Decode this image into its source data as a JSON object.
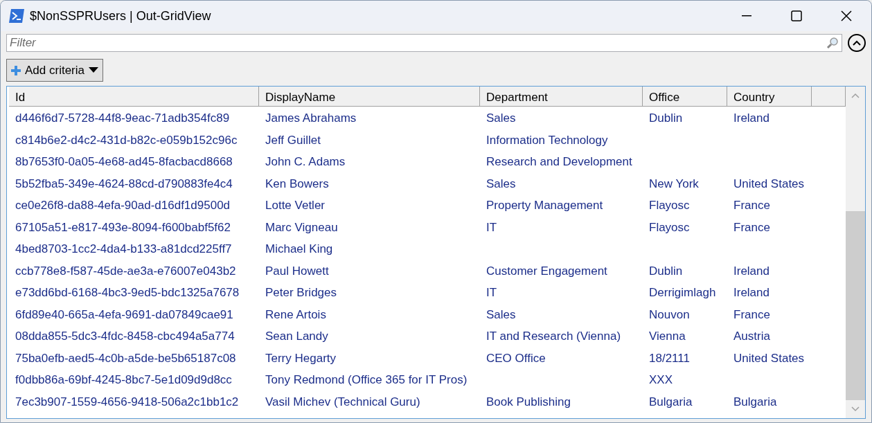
{
  "window": {
    "title": "$NonSSPRUsers | Out-GridView"
  },
  "filter": {
    "placeholder": "Filter"
  },
  "add_criteria_button": {
    "label": "Add criteria"
  },
  "table": {
    "columns": [
      "Id",
      "DisplayName",
      "Department",
      "Office",
      "Country"
    ],
    "rows": [
      [
        "d446f6d7-5728-44f8-9eac-71adb354fc89",
        "James Abrahams",
        "Sales",
        "Dublin",
        "Ireland"
      ],
      [
        "c814b6e2-d4c2-431d-b82c-e059b152c96c",
        "Jeff Guillet",
        "Information Technology",
        "",
        ""
      ],
      [
        "8b7653f0-0a05-4e68-ad45-8facbacd8668",
        "John C. Adams",
        "Research and Development",
        "",
        ""
      ],
      [
        "5b52fba5-349e-4624-88cd-d790883fe4c4",
        "Ken Bowers",
        "Sales",
        "New York",
        "United States"
      ],
      [
        "ce0e26f8-da88-4efa-90ad-d16df1d9500d",
        "Lotte Vetler",
        "Property Management",
        "Flayosc",
        "France"
      ],
      [
        "67105a51-e817-493e-8094-f600babf5f62",
        "Marc Vigneau",
        "IT",
        "Flayosc",
        "France"
      ],
      [
        "4bed8703-1cc2-4da4-b133-a81dcd225ff7",
        "Michael King",
        "",
        "",
        ""
      ],
      [
        "ccb778e8-f587-45de-ae3a-e76007e043b2",
        "Paul Howett",
        "Customer Engagement",
        "Dublin",
        "Ireland"
      ],
      [
        "e73dd6bd-6168-4bc3-9ed5-bdc1325a7678",
        "Peter Bridges",
        "IT",
        "Derrigimlagh",
        "Ireland"
      ],
      [
        "6fd89e40-665a-4efa-9691-da07849cae91",
        "Rene Artois",
        "Sales",
        "Nouvon",
        "France"
      ],
      [
        "08dda855-5dc3-4fdc-8458-cbc494a5a774",
        "Sean Landy",
        "IT and Research (Vienna)",
        "Vienna",
        "Austria"
      ],
      [
        "75ba0efb-aed5-4c0b-a5de-be5b65187c08",
        "Terry Hegarty",
        "CEO Office",
        "18/2111",
        "United States"
      ],
      [
        "f0dbb86a-69bf-4245-8bc7-5e1d09d9d8cc",
        "Tony Redmond (Office 365 for IT Pros)",
        "",
        "XXX",
        ""
      ],
      [
        "7ec3b907-1559-4656-9418-506a2c1bb1c2",
        "Vasil Michev (Technical Guru)",
        "Book Publishing",
        "Bulgaria",
        "Bulgaria"
      ]
    ]
  }
}
